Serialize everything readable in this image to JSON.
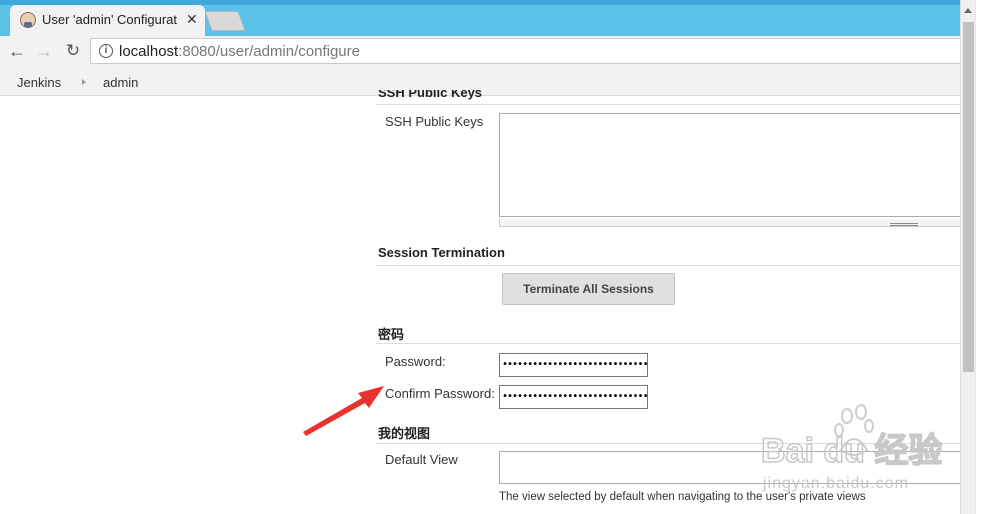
{
  "browser": {
    "tab_title": "User 'admin' Configurat",
    "tab_close": "✕",
    "url_host": "localhost",
    "url_rest": ":8080/user/admin/configure"
  },
  "breadcrumb": {
    "items": [
      "Jenkins",
      "admin"
    ]
  },
  "sections": {
    "ssh_cut_title": "SSH Public Keys",
    "ssh_label": "SSH Public Keys",
    "session_title": "Session Termination",
    "terminate_button": "Terminate All Sessions",
    "password_title": "密码",
    "password_label": "Password:",
    "password_value": "••••••••••••••••••••••••••••••••••••••••••",
    "confirm_label": "Confirm Password:",
    "confirm_value": "••••••••••••••••••••••••••••••••••••••••••",
    "myview_title": "我的视图",
    "default_view_label": "Default View",
    "default_view_help": "The view selected by default when navigating to the user's private views"
  },
  "watermark": {
    "brand": "Bai du 经验",
    "url": "jingyan.baidu.com"
  },
  "colors": {
    "tabstrip": "#5bc2e8",
    "arrow": "#e8322d"
  }
}
